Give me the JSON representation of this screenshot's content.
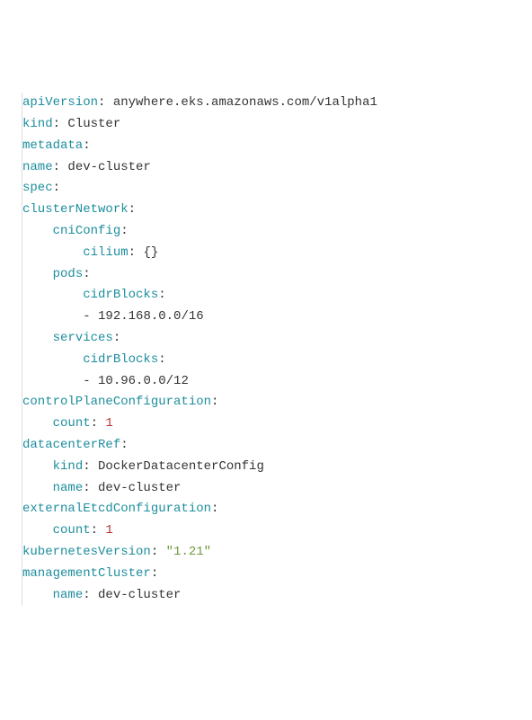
{
  "lines": [
    {
      "indent": 0,
      "key": "apiVersion",
      "sep": ":",
      "value": " anywhere.eks.amazonaws.com/v1alpha1",
      "valueClass": "yaml-value"
    },
    {
      "indent": 0,
      "key": "kind",
      "sep": ":",
      "value": " Cluster",
      "valueClass": "yaml-value"
    },
    {
      "indent": 0,
      "key": "metadata",
      "sep": ":",
      "value": "",
      "valueClass": ""
    },
    {
      "indent": 0,
      "key": "name",
      "sep": ":",
      "value": " dev-cluster",
      "valueClass": "yaml-value"
    },
    {
      "indent": 0,
      "key": "spec",
      "sep": ":",
      "value": "",
      "valueClass": ""
    },
    {
      "indent": 0,
      "key": "clusterNetwork",
      "sep": ":",
      "value": "",
      "valueClass": ""
    },
    {
      "indent": 1,
      "key": "cniConfig",
      "sep": ":",
      "value": "",
      "valueClass": ""
    },
    {
      "indent": 2,
      "key": "cilium",
      "sep": ":",
      "value": " {}",
      "valueClass": "yaml-brace"
    },
    {
      "indent": 1,
      "key": "pods",
      "sep": ":",
      "value": "",
      "valueClass": ""
    },
    {
      "indent": 2,
      "key": "cidrBlocks",
      "sep": ":",
      "value": "",
      "valueClass": ""
    },
    {
      "indent": 2,
      "dash": "- ",
      "key": "",
      "sep": "",
      "value": "192.168.0.0/16",
      "valueClass": "yaml-value"
    },
    {
      "indent": 1,
      "key": "services",
      "sep": ":",
      "value": "",
      "valueClass": ""
    },
    {
      "indent": 2,
      "key": "cidrBlocks",
      "sep": ":",
      "value": "",
      "valueClass": ""
    },
    {
      "indent": 2,
      "dash": "- ",
      "key": "",
      "sep": "",
      "value": "10.96.0.0/12",
      "valueClass": "yaml-value"
    },
    {
      "indent": 0,
      "key": "controlPlaneConfiguration",
      "sep": ":",
      "value": "",
      "valueClass": ""
    },
    {
      "indent": 1,
      "key": "count",
      "sep": ":",
      "value": " 1",
      "valueClass": "yaml-number"
    },
    {
      "indent": 0,
      "key": "datacenterRef",
      "sep": ":",
      "value": "",
      "valueClass": ""
    },
    {
      "indent": 1,
      "key": "kind",
      "sep": ":",
      "value": " DockerDatacenterConfig",
      "valueClass": "yaml-value"
    },
    {
      "indent": 1,
      "key": "name",
      "sep": ":",
      "value": " dev-cluster",
      "valueClass": "yaml-value"
    },
    {
      "indent": 0,
      "key": "externalEtcdConfiguration",
      "sep": ":",
      "value": "",
      "valueClass": ""
    },
    {
      "indent": 1,
      "key": "count",
      "sep": ":",
      "value": " 1",
      "valueClass": "yaml-number"
    },
    {
      "indent": 0,
      "key": "kubernetesVersion",
      "sep": ":",
      "value": " \"1.21\"",
      "valueClass": "yaml-string"
    },
    {
      "indent": 0,
      "key": "managementCluster",
      "sep": ":",
      "value": "",
      "valueClass": ""
    },
    {
      "indent": 1,
      "key": "name",
      "sep": ":",
      "value": " dev-cluster",
      "valueClass": "yaml-value"
    }
  ]
}
